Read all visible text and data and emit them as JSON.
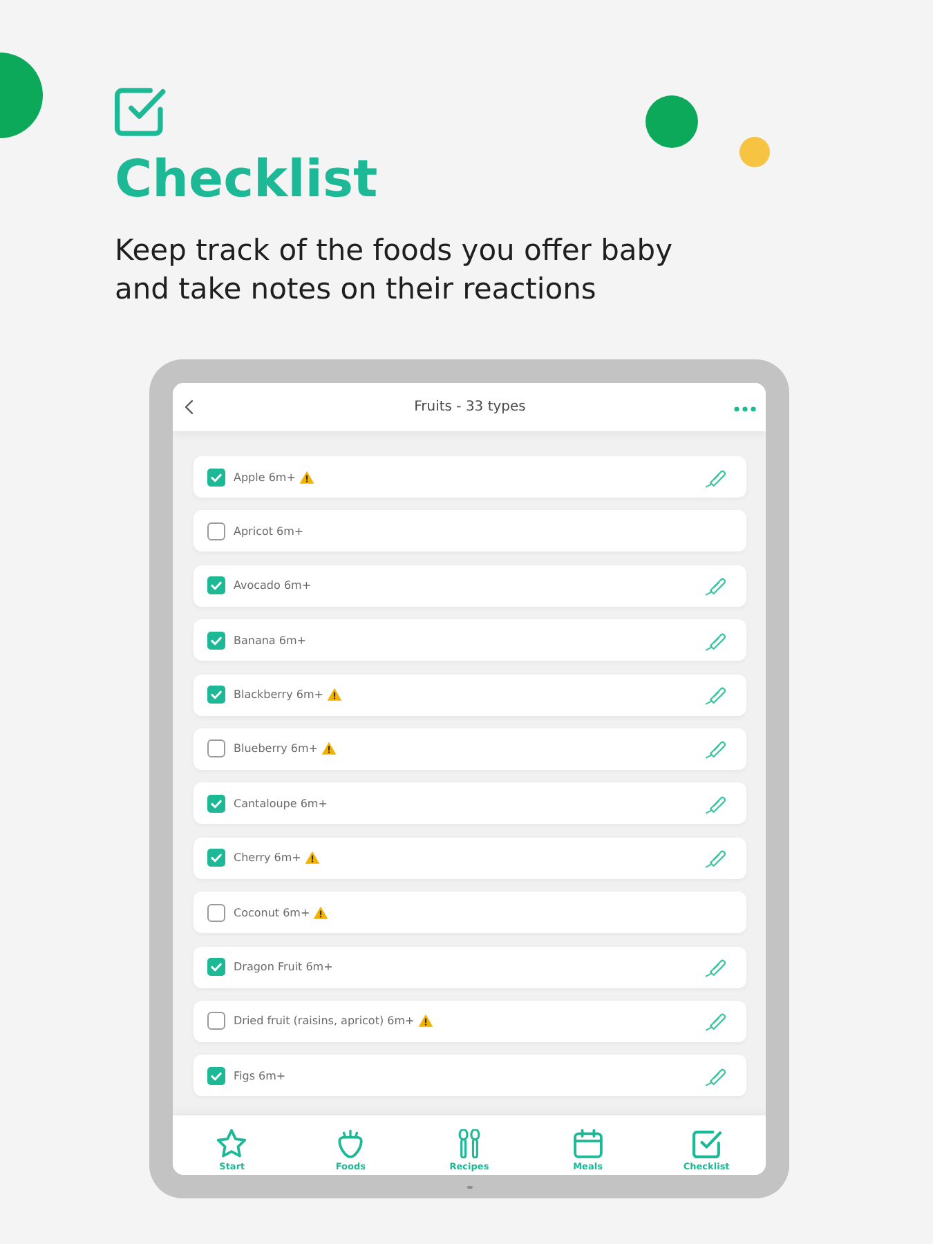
{
  "hero": {
    "title": "Checklist",
    "subtitle": "Keep track of the foods you offer baby and take notes on their reactions"
  },
  "screen": {
    "title": "Fruits - 33 types",
    "items": [
      {
        "label": "Apple 6m+",
        "checked": true,
        "warning": true,
        "has_note": true
      },
      {
        "label": "Apricot 6m+",
        "checked": false,
        "warning": false,
        "has_note": false
      },
      {
        "label": "Avocado 6m+",
        "checked": true,
        "warning": false,
        "has_note": true
      },
      {
        "label": "Banana 6m+",
        "checked": true,
        "warning": false,
        "has_note": true
      },
      {
        "label": "Blackberry 6m+",
        "checked": true,
        "warning": true,
        "has_note": true
      },
      {
        "label": "Blueberry 6m+",
        "checked": false,
        "warning": true,
        "has_note": true
      },
      {
        "label": "Cantaloupe 6m+",
        "checked": true,
        "warning": false,
        "has_note": true
      },
      {
        "label": "Cherry 6m+",
        "checked": true,
        "warning": true,
        "has_note": true
      },
      {
        "label": "Coconut 6m+",
        "checked": false,
        "warning": true,
        "has_note": false
      },
      {
        "label": "Dragon Fruit 6m+",
        "checked": true,
        "warning": false,
        "has_note": true
      },
      {
        "label": "Dried fruit (raisins, apricot) 6m+",
        "checked": false,
        "warning": true,
        "has_note": true
      },
      {
        "label": "Figs 6m+",
        "checked": true,
        "warning": false,
        "has_note": true
      }
    ]
  },
  "nav": [
    {
      "label": "Start",
      "kind": "star"
    },
    {
      "label": "Foods",
      "kind": "strawberry"
    },
    {
      "label": "Recipes",
      "kind": "utensils"
    },
    {
      "label": "Meals",
      "kind": "calendar"
    },
    {
      "label": "Checklist",
      "kind": "checklist"
    }
  ]
}
